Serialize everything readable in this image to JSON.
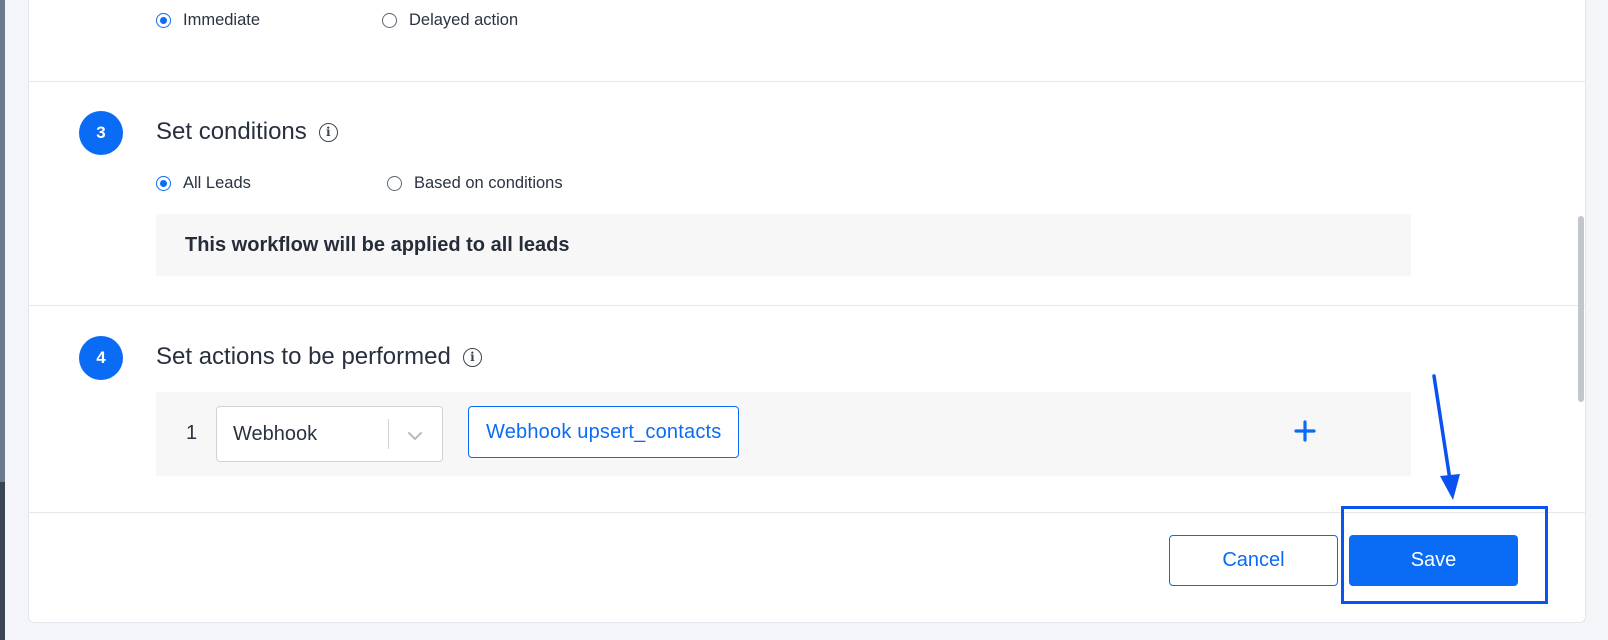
{
  "timing": {
    "options": [
      {
        "label": "Immediate",
        "checked": true
      },
      {
        "label": "Delayed action",
        "checked": false
      }
    ]
  },
  "step3": {
    "number": "3",
    "title": "Set conditions",
    "info_icon": "info-icon",
    "options": [
      {
        "label": "All Leads",
        "checked": true
      },
      {
        "label": "Based on conditions",
        "checked": false
      }
    ],
    "note": "This workflow will be applied to all leads"
  },
  "step4": {
    "number": "4",
    "title": "Set actions to be performed",
    "info_icon": "info-icon",
    "actions": [
      {
        "index": "1",
        "type": "Webhook",
        "detail": "Webhook upsert_contacts"
      }
    ],
    "add_icon": "plus-icon"
  },
  "footer": {
    "cancel_label": "Cancel",
    "save_label": "Save"
  },
  "colors": {
    "accent": "#0a6cf5",
    "annotation": "#0a53f0"
  }
}
